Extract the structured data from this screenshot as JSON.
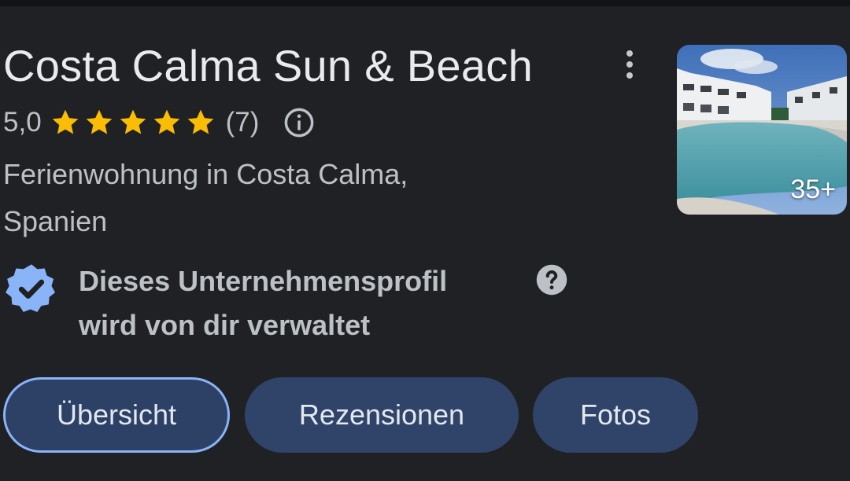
{
  "place": {
    "name": "Costa Calma Sun & Beach",
    "rating": "5,0",
    "stars": 5,
    "review_count": "(7)",
    "category_line1": "Ferienwohnung in Costa Calma,",
    "category_line2": "Spanien",
    "photo_count": "35+"
  },
  "verified": {
    "line1": "Dieses Unternehmensprofil",
    "line2": "wird von dir verwaltet"
  },
  "tabs": [
    {
      "label": "Übersicht",
      "active": true
    },
    {
      "label": "Rezensionen",
      "active": false
    },
    {
      "label": "Fotos",
      "active": false
    }
  ],
  "colors": {
    "background": "#202124",
    "star": "#fbbc04",
    "verified_badge": "#8ab4f8",
    "tab_fill": "#2f4468",
    "tab_active_border": "#8ab4f8"
  },
  "icons": {
    "menu": "more-vert-icon",
    "info": "info-icon",
    "verified": "verified-badge-icon",
    "help": "help-icon"
  }
}
